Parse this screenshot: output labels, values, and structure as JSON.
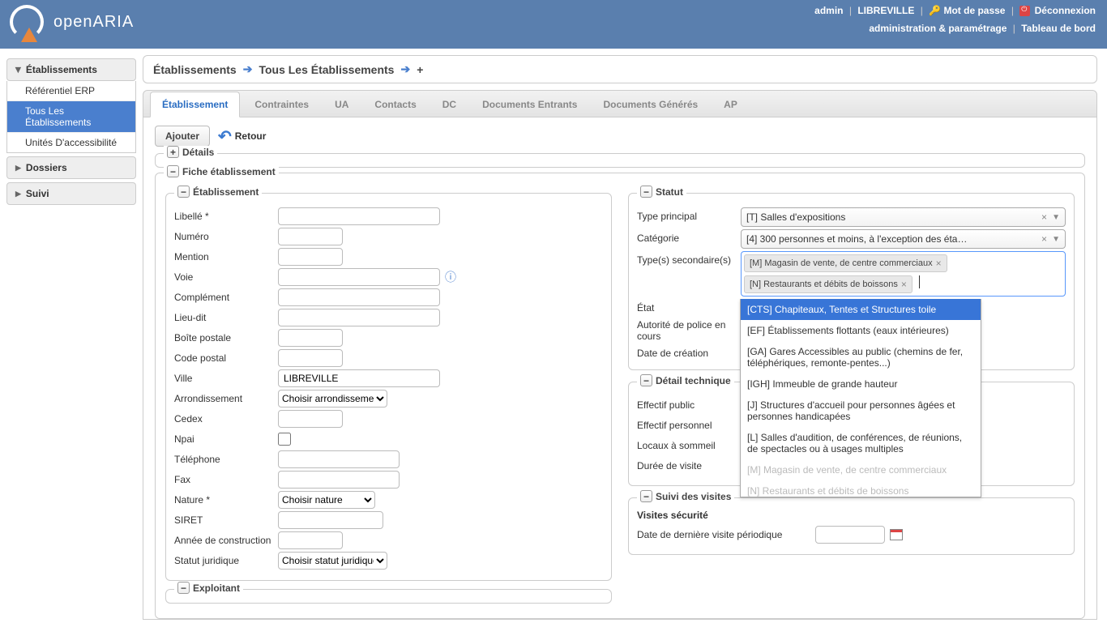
{
  "header": {
    "app_name": "openARIA",
    "user": "admin",
    "location": "LIBREVILLE",
    "password_link": "Mot de passe",
    "logout": "Déconnexion",
    "admin_link": "administration & paramétrage",
    "dashboard_link": "Tableau de bord"
  },
  "sidebar": {
    "sections": [
      {
        "title": "Établissements",
        "expanded": true,
        "items": [
          {
            "label": "Référentiel ERP",
            "selected": false
          },
          {
            "label": "Tous Les Établissements",
            "selected": true
          },
          {
            "label": "Unités D'accessibilité",
            "selected": false
          }
        ]
      },
      {
        "title": "Dossiers",
        "expanded": false
      },
      {
        "title": "Suivi",
        "expanded": false
      }
    ]
  },
  "breadcrumb": {
    "parts": [
      "Établissements",
      "Tous Les Établissements",
      "+"
    ]
  },
  "tabs": [
    "Établissement",
    "Contraintes",
    "UA",
    "Contacts",
    "DC",
    "Documents Entrants",
    "Documents Générés",
    "AP"
  ],
  "actions": {
    "add": "Ajouter",
    "back": "Retour"
  },
  "fieldsets": {
    "details": "Détails",
    "fiche": "Fiche établissement",
    "etablissement": "Établissement",
    "statut": "Statut",
    "detail_tech": "Détail technique",
    "suivi": "Suivi des visites",
    "exploitant": "Exploitant"
  },
  "form_etab": {
    "libelle": "Libellé *",
    "numero": "Numéro",
    "mention": "Mention",
    "voie": "Voie",
    "complement": "Complément",
    "lieu_dit": "Lieu-dit",
    "boite_postale": "Boîte postale",
    "code_postal": "Code postal",
    "ville": "Ville",
    "ville_value": "LIBREVILLE",
    "arrondissement": "Arrondissement",
    "arrondissement_placeholder": "Choisir arrondissement",
    "cedex": "Cedex",
    "npai": "Npai",
    "telephone": "Téléphone",
    "fax": "Fax",
    "nature": "Nature *",
    "nature_placeholder": "Choisir nature",
    "siret": "SIRET",
    "annee": "Année de construction",
    "statut_j": "Statut juridique",
    "statut_j_placeholder": "Choisir statut juridique"
  },
  "form_statut": {
    "type_principal": "Type principal",
    "type_principal_value": "[T] Salles d'expositions",
    "categorie": "Catégorie",
    "categorie_value": "[4] 300 personnes et moins, à l'exception des éta…",
    "types_secondaires": "Type(s) secondaire(s)",
    "chips": [
      "[M] Magasin de vente, de centre commerciaux",
      "[N] Restaurants et débits de boissons"
    ],
    "etat": "État",
    "autorite": "Autorité de police en cours",
    "date_creation": "Date de création"
  },
  "dropdown_options": [
    {
      "label": "[CTS] Chapiteaux, Tentes et Structures toile",
      "highlight": true
    },
    {
      "label": "[EF] Établissements flottants (eaux intérieures)"
    },
    {
      "label": "[GA] Gares Accessibles au public (chemins de fer, téléphériques, remonte-pentes...)"
    },
    {
      "label": "[IGH] Immeuble de grande hauteur"
    },
    {
      "label": "[J] Structures d'accueil pour personnes âgées et personnes handicapées"
    },
    {
      "label": "[L] Salles d'audition, de conférences, de réunions, de spectacles ou à usages multiples"
    },
    {
      "label": "[M] Magasin de vente, de centre commerciaux",
      "disabled": true
    },
    {
      "label": "[N] Restaurants et débits de boissons",
      "disabled": true
    }
  ],
  "form_tech": {
    "effectif_public": "Effectif public",
    "effectif_personnel": "Effectif personnel",
    "locaux_sommeil": "Locaux à sommeil",
    "duree_visite": "Durée de visite"
  },
  "form_visites": {
    "title": "Visites sécurité",
    "date_derniere": "Date de dernière visite périodique"
  }
}
